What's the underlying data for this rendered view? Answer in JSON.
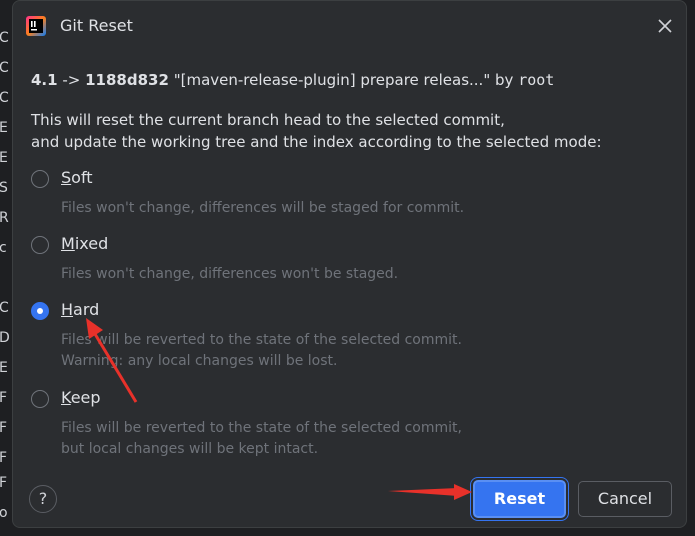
{
  "background_chars": [
    "C",
    "C",
    "C",
    "E",
    "E",
    "S",
    "R",
    "c",
    "C",
    "D",
    "E",
    "F",
    "F",
    "F",
    "F",
    "o"
  ],
  "dialog": {
    "title": "Git Reset",
    "commit": {
      "version": "4.1",
      "arrow": "->",
      "hash": "1188d832",
      "message": "\"[maven-release-plugin] prepare releas...\"",
      "by": "by",
      "author": "root"
    },
    "description": [
      "This will reset the current branch head to the selected commit,",
      "and update the working tree and the index according to the selected mode:"
    ],
    "options": [
      {
        "mnemonic": "S",
        "rest": "oft",
        "hint": [
          "Files won't change, differences will be staged for commit."
        ],
        "checked": false
      },
      {
        "mnemonic": "M",
        "rest": "ixed",
        "hint": [
          "Files won't change, differences won't be staged."
        ],
        "checked": false
      },
      {
        "mnemonic": "H",
        "rest": "ard",
        "hint": [
          "Files will be reverted to the state of the selected commit.",
          "Warning: any local changes will be lost."
        ],
        "checked": true
      },
      {
        "mnemonic": "K",
        "rest": "eep",
        "hint": [
          "Files will be reverted to the state of the selected commit,",
          "but local changes will be kept intact."
        ],
        "checked": false
      }
    ],
    "help_label": "?",
    "reset_label": "Reset",
    "cancel_label": "Cancel"
  },
  "colors": {
    "accent": "#3574f0",
    "annotation_arrow": "#e8312a",
    "background": "#2b2d30"
  },
  "icons": {
    "app": "intellij-app-icon",
    "close": "close-icon",
    "help": "help-icon"
  }
}
